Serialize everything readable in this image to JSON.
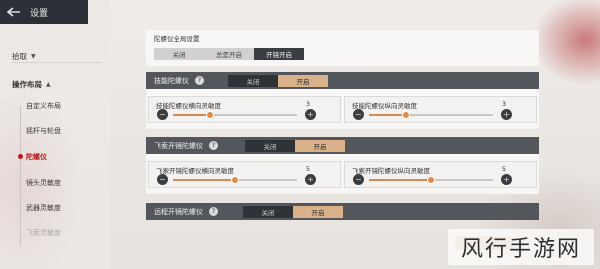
{
  "topbar": {
    "title": "设置"
  },
  "sidebar": {
    "items": [
      {
        "label": "拾取",
        "expanded": false
      },
      {
        "label": "操作布局",
        "expanded": true
      }
    ],
    "sub_items": [
      "自定义布局",
      "摇杆与轮盘",
      "陀螺仪",
      "镜头灵敏度",
      "武器灵敏度",
      "飞索灵敏度"
    ],
    "active": "陀螺仪"
  },
  "global": {
    "title": "陀螺仪全局设置",
    "options": [
      "关闭",
      "总是开启",
      "开镜开启"
    ],
    "selected": "开镜开启"
  },
  "skill": {
    "title": "技能陀螺仪",
    "toggle": [
      "关闭",
      "开启"
    ],
    "selected": "开启",
    "h_label": "技能陀螺仪横向灵敏度",
    "h_value": "3",
    "h_level": 0.3,
    "v_label": "技能陀螺仪纵向灵敏度",
    "v_value": "3",
    "v_level": 0.3
  },
  "fly": {
    "title": "飞索开镜陀螺仪",
    "toggle": [
      "关闭",
      "开启"
    ],
    "selected": "开启",
    "h_label": "飞索开镜陀螺仪横向灵敏度",
    "h_value": "5",
    "h_level": 0.5,
    "v_label": "飞索开镜陀螺仪纵向灵敏度",
    "v_value": "5",
    "v_level": 0.5
  },
  "ranged": {
    "title": "远程开镜陀螺仪",
    "toggle": [
      "关闭",
      "开启"
    ],
    "selected": "开启"
  },
  "icons": {
    "help": "?",
    "minus": "−",
    "plus": "+"
  },
  "watermark": "风行手游网",
  "colors": {
    "accent": "#b3171b",
    "knob": "#e08b45",
    "toggle_on": "#d9b28b"
  }
}
